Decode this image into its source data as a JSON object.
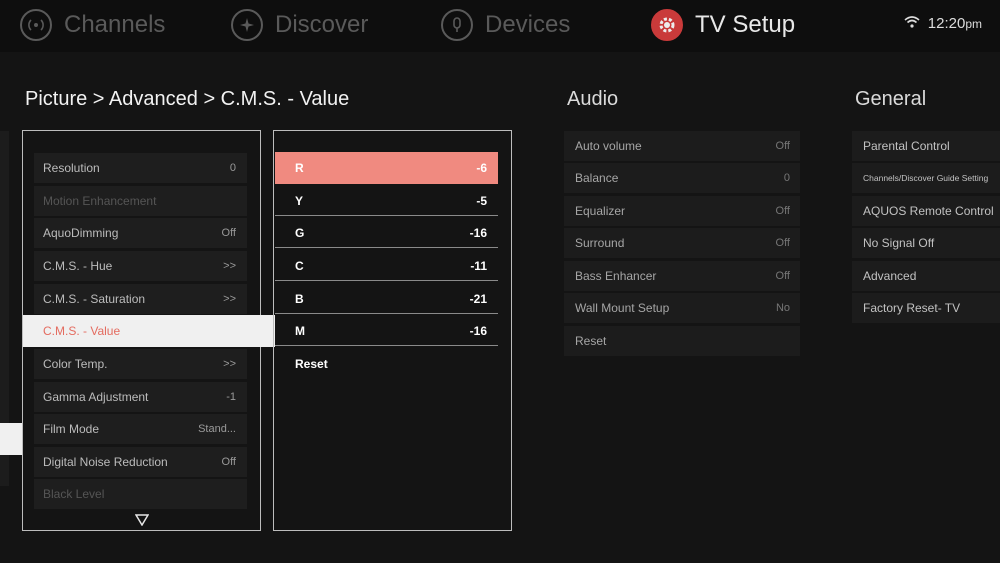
{
  "nav": {
    "items": [
      {
        "label": "Channels",
        "icon": "channels-icon"
      },
      {
        "label": "Discover",
        "icon": "discover-icon"
      },
      {
        "label": "Devices",
        "icon": "devices-icon"
      },
      {
        "label": "TV Setup",
        "icon": "gear-icon"
      }
    ],
    "active": "TV Setup",
    "time": "12:20",
    "ampm": "pm",
    "status_icon": "wifi-icon"
  },
  "colors": {
    "accent": "#c93a3a",
    "highlight": "#f08a80",
    "selected_text": "#e46c60"
  },
  "breadcrumb": "Picture > Advanced > C.M.S. - Value",
  "picture_menu": {
    "items": [
      {
        "label": "Resolution",
        "value": "0"
      },
      {
        "label": "Motion Enhancement",
        "value": ""
      },
      {
        "label": "AquoDimming",
        "value": "Off"
      },
      {
        "label": "C.M.S. - Hue",
        "value": ">>"
      },
      {
        "label": "C.M.S. - Saturation",
        "value": ">>"
      },
      {
        "label": "C.M.S. - Value",
        "value": ""
      },
      {
        "label": "Color Temp.",
        "value": ">>"
      },
      {
        "label": "Gamma Adjustment",
        "value": "-1"
      },
      {
        "label": "Film Mode",
        "value": "Stand..."
      },
      {
        "label": "Digital Noise Reduction",
        "value": "Off"
      },
      {
        "label": "Black Level",
        "value": ""
      }
    ],
    "selected": "C.M.S. - Value",
    "scroll_icon": "triangle-down-icon"
  },
  "cms_value": {
    "items": [
      {
        "label": "R",
        "value": "-6"
      },
      {
        "label": "Y",
        "value": "-5"
      },
      {
        "label": "G",
        "value": "-16"
      },
      {
        "label": "C",
        "value": "-11"
      },
      {
        "label": "B",
        "value": "-21"
      },
      {
        "label": "M",
        "value": "-16"
      }
    ],
    "selected": "R",
    "reset_label": "Reset"
  },
  "audio": {
    "title": "Audio",
    "items": [
      {
        "label": "Auto volume",
        "value": "Off"
      },
      {
        "label": "Balance",
        "value": "0"
      },
      {
        "label": "Equalizer",
        "value": "Off"
      },
      {
        "label": "Surround",
        "value": "Off"
      },
      {
        "label": "Bass Enhancer",
        "value": "Off"
      },
      {
        "label": "Wall Mount Setup",
        "value": "No"
      },
      {
        "label": "Reset",
        "value": ""
      }
    ]
  },
  "general": {
    "title": "General",
    "items": [
      {
        "label": "Parental Control"
      },
      {
        "label": "Channels/Discover Guide Setting"
      },
      {
        "label": "AQUOS Remote Control"
      },
      {
        "label": "No Signal Off"
      },
      {
        "label": "Advanced"
      },
      {
        "label": "Factory Reset- TV"
      }
    ]
  }
}
